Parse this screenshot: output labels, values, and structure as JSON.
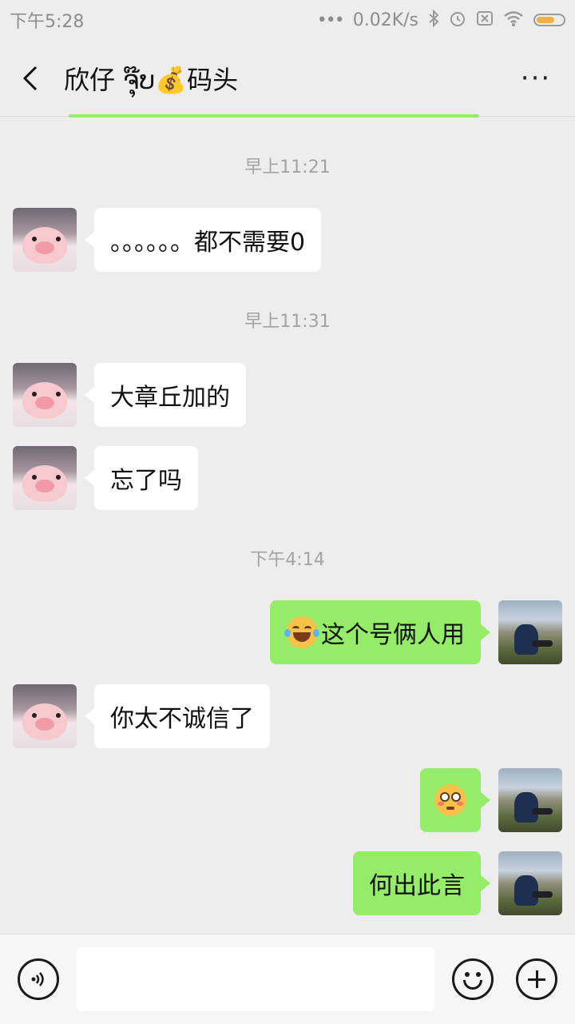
{
  "status_bar": {
    "time": "下午5:28",
    "dots": "•••",
    "network_speed": "0.02K/s",
    "icons": [
      "bluetooth-icon",
      "alarm-icon",
      "sim-icon",
      "wifi-icon",
      "battery-icon"
    ]
  },
  "header": {
    "title": "欣仔 ຈຸ໊ບ💰码头",
    "back_icon": "chevron-left-icon",
    "more_label": "···"
  },
  "messages": [
    {
      "type": "timestamp",
      "text": "早上11:21"
    },
    {
      "type": "incoming",
      "text": "。。。。。。都不需要0"
    },
    {
      "type": "timestamp",
      "text": "早上11:31"
    },
    {
      "type": "incoming",
      "text": "大章丘加的"
    },
    {
      "type": "incoming",
      "text": "忘了吗"
    },
    {
      "type": "timestamp",
      "text": "下午4:14"
    },
    {
      "type": "outgoing",
      "emoji": "tears-of-joy",
      "text": "这个号俩人用"
    },
    {
      "type": "incoming",
      "text": "你太不诚信了"
    },
    {
      "type": "outgoing",
      "emoji": "flushed-face",
      "text": ""
    },
    {
      "type": "outgoing",
      "text": "何出此言"
    }
  ],
  "colors": {
    "background": "#ededed",
    "outgoing_bubble": "#95ec69",
    "incoming_bubble": "#ffffff",
    "timestamp": "#a3a3a3"
  },
  "input_bar": {
    "placeholder": "",
    "icons": [
      "voice-icon",
      "emoji-icon",
      "plus-icon"
    ]
  }
}
